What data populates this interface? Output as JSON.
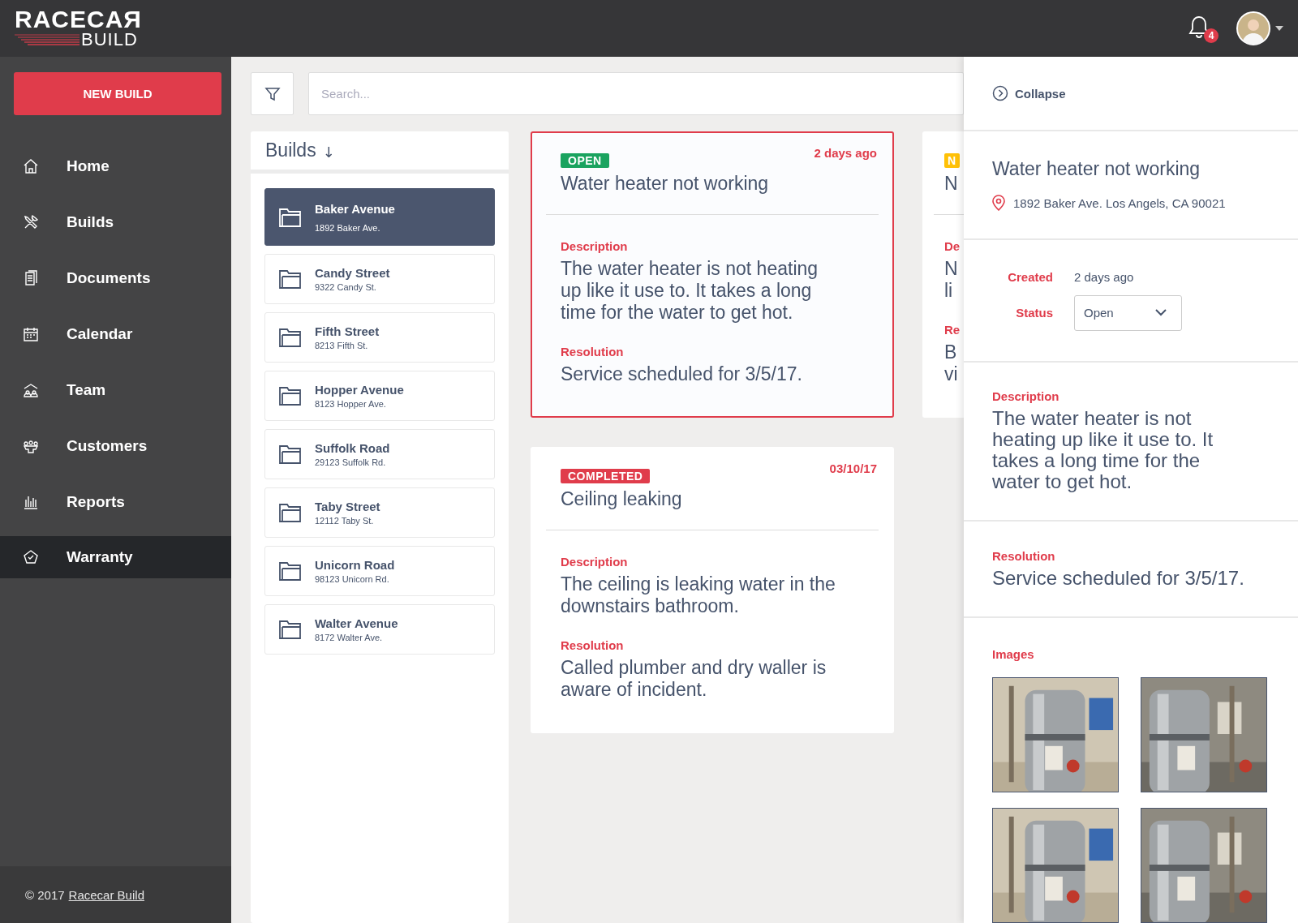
{
  "header": {
    "logo_top": "RACECAЯ",
    "logo_bottom": "BUILD",
    "notification_count": "4"
  },
  "sidebar": {
    "new_build": "NEW BUILD",
    "items": [
      {
        "label": "Home",
        "selected": false
      },
      {
        "label": "Builds",
        "selected": false
      },
      {
        "label": "Documents",
        "selected": false
      },
      {
        "label": "Calendar",
        "selected": false
      },
      {
        "label": "Team",
        "selected": false
      },
      {
        "label": "Customers",
        "selected": false
      },
      {
        "label": "Reports",
        "selected": false
      },
      {
        "label": "Warranty",
        "selected": true
      }
    ],
    "footer": {
      "copyright": "© 2017",
      "link": "Racecar Build"
    }
  },
  "search": {
    "placeholder": "Search..."
  },
  "builds": {
    "title": "Builds",
    "sort_arrow": "↓",
    "items": [
      {
        "name": "Baker Avenue",
        "address": "1892 Baker Ave.",
        "selected": true
      },
      {
        "name": "Candy Street",
        "address": "9322 Candy St.",
        "selected": false
      },
      {
        "name": "Fifth Street",
        "address": "8213 Fifth St.",
        "selected": false
      },
      {
        "name": "Hopper Avenue",
        "address": "8123 Hopper Ave.",
        "selected": false
      },
      {
        "name": "Suffolk Road",
        "address": "29123 Suffolk Rd.",
        "selected": false
      },
      {
        "name": "Taby Street",
        "address": "12112 Taby St.",
        "selected": false
      },
      {
        "name": "Unicorn Road",
        "address": "98123 Unicorn Rd.",
        "selected": false
      },
      {
        "name": "Walter Avenue",
        "address": "8172 Walter Ave.",
        "selected": false
      }
    ]
  },
  "cards": [
    {
      "status": "OPEN",
      "color": "#1aa35f",
      "date": "2 days ago",
      "title": "Water heater not working",
      "description_label": "Description",
      "description": "The water heater is not heating\nup like it use to. It takes a long\ntime for the water to get hot.",
      "resolution_label": "Resolution",
      "resolution": "Service scheduled for 3/5/17.",
      "selected": true
    },
    {
      "status": "COMPLETED",
      "color": "#e03c4b",
      "date": "03/10/17",
      "title": "Ceiling leaking",
      "description_label": "Description",
      "description": "The ceiling is leaking water in the\ndownstairs bathroom.",
      "resolution_label": "Resolution",
      "resolution": "Called plumber and dry waller is\naware of incident.",
      "selected": false
    },
    {
      "status": "N",
      "color": "#ffc107",
      "title": "N",
      "description_label": "De",
      "description": "N\nli",
      "resolution_label": "Re",
      "resolution": "B\nvi",
      "selected": false
    }
  ],
  "detail": {
    "collapse": "Collapse",
    "title": "Water heater not working",
    "address": "1892 Baker Ave. Los Angels, CA 90021",
    "created_label": "Created",
    "created": "2 days ago",
    "status_label": "Status",
    "status_value": "Open",
    "description_label": "Description",
    "description": "The water heater is not heating up like it use to. It takes a long time for the water to get hot.",
    "resolution_label": "Resolution",
    "resolution": "Service scheduled for 3/5/17.",
    "images_label": "Images"
  }
}
